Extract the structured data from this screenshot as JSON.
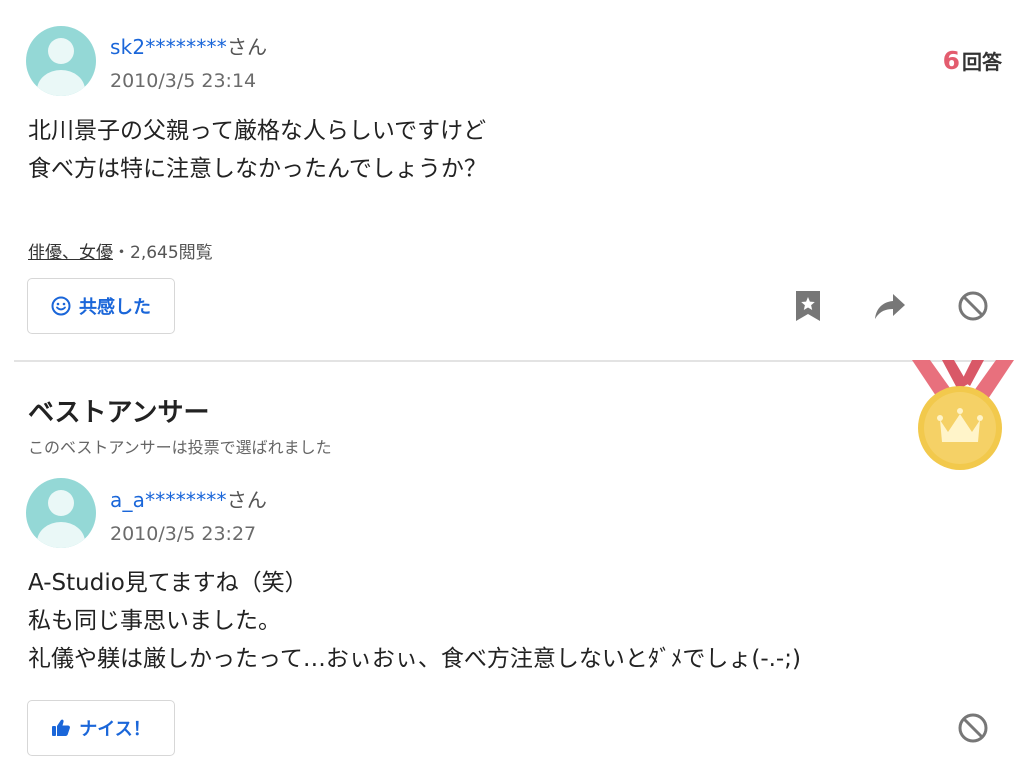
{
  "question": {
    "user": {
      "name": "sk2********",
      "suffix": "さん"
    },
    "timestamp": "2010/3/5 23:14",
    "answer_count": {
      "number": "6",
      "label": "回答"
    },
    "body_lines": [
      "北川景子の父親って厳格な人らしいですけど",
      "食べ方は特に注意しなかったんでしょうか？"
    ],
    "category": "俳優、女優",
    "views": "・2,645閲覧",
    "empathy_label": "共感した",
    "icons": {
      "bookmark": "bookmark-star-icon",
      "share": "share-arrow-icon",
      "block": "block-icon"
    }
  },
  "best_answer": {
    "title": "ベストアンサー",
    "subtitle": "このベストアンサーは投票で選ばれました",
    "user": {
      "name": "a_a********",
      "suffix": "さん"
    },
    "timestamp": "2010/3/5 23:27",
    "body_lines": [
      "A-Studio見てますね（笑）",
      "私も同じ事思いました。",
      "礼儀や躾は厳しかったって…おぃおぃ、食べ方注意しないとﾀﾞﾒでしょ(-.-;)"
    ],
    "nice_label": "ナイス！",
    "medal_icon": "crown-medal-icon"
  },
  "colors": {
    "link_blue": "#1a66d9",
    "answer_count_red": "#e35c6e",
    "avatar_teal": "#94d8d6",
    "medal_gold": "#f2c94c",
    "ribbon_red": "#e8707d"
  }
}
